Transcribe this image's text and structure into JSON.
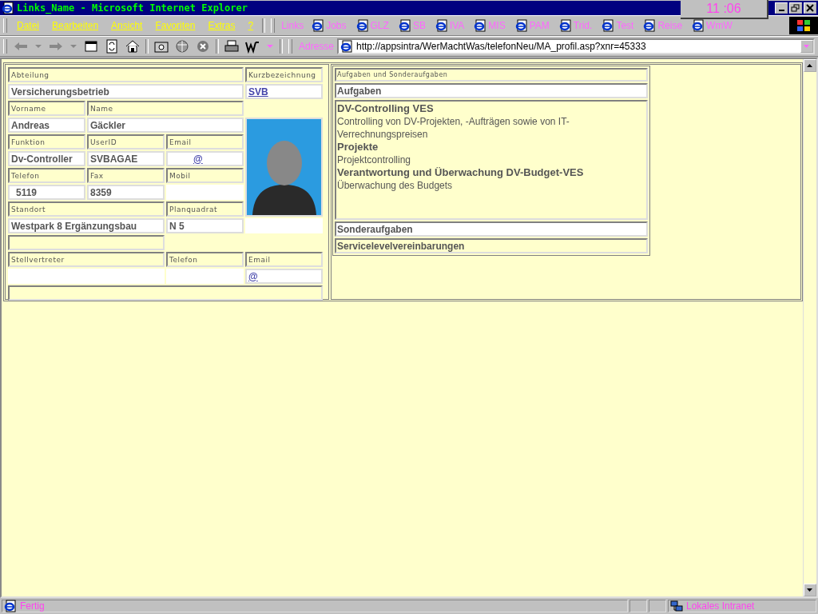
{
  "window": {
    "title": "Links_Name - Microsoft Internet Explorer",
    "clock": "11 :06"
  },
  "menu": [
    "Datei",
    "Bearbeiten",
    "Ansicht",
    "Favoriten",
    "Extras",
    "?"
  ],
  "links": {
    "label": "Links",
    "items": [
      "Jobs",
      "GLZ",
      "SB",
      "IVA",
      "MIS",
      "PAM",
      "Trid.",
      "Test",
      "Reise",
      "WmW"
    ]
  },
  "address": {
    "label": "Adresse",
    "url": "http://appsintra/WerMachtWas/telefonNeu/MA_profil.asp?xnr=45333"
  },
  "profile": [
    {
      "kind": "label",
      "text": "Abteilung"
    },
    {
      "kind": "label",
      "text": "Kurzbezeichnung"
    },
    {
      "kind": "value",
      "text": "Versicherungsbetrieb"
    },
    {
      "kind": "link",
      "text": "SVB"
    },
    {
      "kind": "label",
      "text": "Vorname"
    },
    {
      "kind": "label",
      "text": "Name"
    },
    {
      "kind": "value",
      "text": "Andreas"
    },
    {
      "kind": "value",
      "text": "Gäckler"
    },
    {
      "kind": "photo"
    },
    {
      "kind": "label",
      "text": "Funktion"
    },
    {
      "kind": "label",
      "text": "UserID"
    },
    {
      "kind": "label",
      "text": "Email"
    },
    {
      "kind": "value",
      "text": "Dv-Controller"
    },
    {
      "kind": "value",
      "text": "SVBAGAE"
    },
    {
      "kind": "link",
      "text": "@"
    },
    {
      "kind": "label",
      "text": "Telefon"
    },
    {
      "kind": "label",
      "text": "Fax"
    },
    {
      "kind": "label",
      "text": "Mobil"
    },
    {
      "kind": "value",
      "text": "5119"
    },
    {
      "kind": "value",
      "text": "8359"
    },
    {
      "kind": "label",
      "text": "Standort"
    },
    {
      "kind": "label",
      "text": "Planquadrat"
    },
    {
      "kind": "value",
      "text": "Westpark 8 Ergänzungsbau"
    },
    {
      "kind": "value",
      "text": "N 5"
    },
    {
      "kind": "label",
      "text": "Stellvertreter"
    },
    {
      "kind": "label",
      "text": "Telefon"
    },
    {
      "kind": "label",
      "text": "Email"
    },
    {
      "kind": "link",
      "text": "@"
    }
  ],
  "tasks_panel": {
    "caption": "Aufgaben und Sonderaufgaben",
    "tasks_heading": "Aufgaben",
    "tasks": [
      {
        "title": "DV-Controlling VES",
        "description": "Controlling von DV-Projekten, -Aufträgen sowie von IT-Verrechnungspreisen"
      },
      {
        "title": "Projekte",
        "description": "Projektcontrolling"
      },
      {
        "title": "Verantwortung und Überwachung DV-Budget-VES",
        "description": "Überwachung des Budgets"
      }
    ],
    "special_heading": "Sonderaufgaben",
    "service_heading": "Servicelevelvereinbarungen"
  },
  "status_bar": {
    "text": "Fertig",
    "zone": "Lokales Intranet"
  }
}
